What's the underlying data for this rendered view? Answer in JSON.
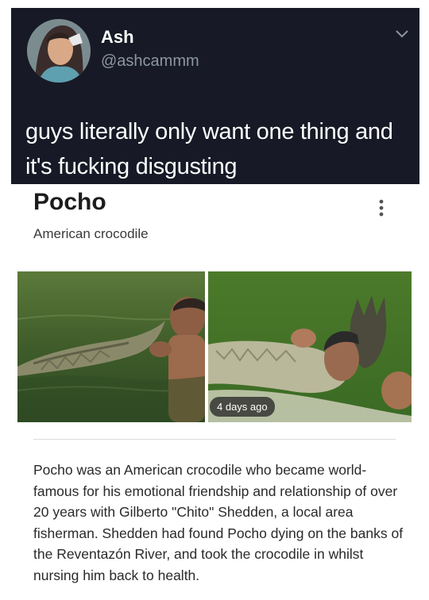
{
  "tweet": {
    "author_name": "Ash",
    "handle": "@ashcammm",
    "text": "guys literally only want one thing and it's fucking disgusting",
    "avatar_icon": "avatar-photo",
    "menu_icon": "chevron-down-icon"
  },
  "knowledge_panel": {
    "title": "Pocho",
    "subtitle": "American crocodile",
    "menu_icon": "more-vert-icon",
    "images": [
      {
        "name": "image-man-kissing-crocodile"
      },
      {
        "name": "image-man-hugging-crocodile",
        "badge": "4 days ago"
      }
    ],
    "description": "Pocho was an American crocodile who became world-famous for his emotional friendship and relationship of over 20 years with Gilberto \"Chito\" Shedden, a local area fisherman. Shedden had found Pocho dying on the banks of the Reventazón River, and took the crocodile in whilst nursing him back to health."
  },
  "colors": {
    "tweet_bg": "#171a26",
    "tweet_text": "#ffffff",
    "handle_text": "#8d95a3",
    "card_title": "#1c1c1c",
    "body_text": "#2a2a2a"
  }
}
